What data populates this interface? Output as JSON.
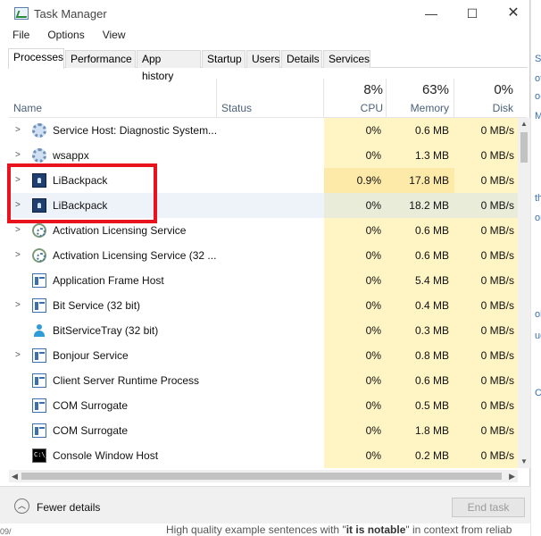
{
  "window": {
    "title": "Task Manager",
    "min": "—",
    "max": "☐",
    "close": "✕"
  },
  "menu": [
    "File",
    "Options",
    "View"
  ],
  "tabs": [
    "Processes",
    "Performance",
    "App history",
    "Startup",
    "Users",
    "Details",
    "Services"
  ],
  "header": {
    "name": "Name",
    "status": "Status",
    "cpu_pct": "8%",
    "cpu": "CPU",
    "mem_pct": "63%",
    "mem": "Memory",
    "disk_pct": "0%",
    "disk": "Disk"
  },
  "rows": [
    {
      "name": "Service Host: Diagnostic System...",
      "cpu": "0%",
      "mem": "0.6 MB",
      "disk": "0 MB/s",
      "icon": "gear-icon",
      "expand": true
    },
    {
      "name": "wsappx",
      "cpu": "0%",
      "mem": "1.3 MB",
      "disk": "0 MB/s",
      "icon": "gear-icon",
      "expand": true
    },
    {
      "name": "LiBackpack",
      "cpu": "0.9%",
      "mem": "17.8 MB",
      "disk": "0 MB/s",
      "icon": "lock-app-icon",
      "expand": true
    },
    {
      "name": "LiBackpack",
      "cpu": "0%",
      "mem": "18.2 MB",
      "disk": "0 MB/s",
      "icon": "lock-app-icon",
      "expand": true
    },
    {
      "name": "Activation Licensing Service",
      "cpu": "0%",
      "mem": "0.6 MB",
      "disk": "0 MB/s",
      "icon": "license-icon",
      "expand": true
    },
    {
      "name": "Activation Licensing Service (32 ...",
      "cpu": "0%",
      "mem": "0.6 MB",
      "disk": "0 MB/s",
      "icon": "license-icon",
      "expand": true
    },
    {
      "name": "Application Frame Host",
      "cpu": "0%",
      "mem": "5.4 MB",
      "disk": "0 MB/s",
      "icon": "window-icon",
      "expand": false
    },
    {
      "name": "Bit Service (32 bit)",
      "cpu": "0%",
      "mem": "0.4 MB",
      "disk": "0 MB/s",
      "icon": "window-icon",
      "expand": true
    },
    {
      "name": "BitServiceTray (32 bit)",
      "cpu": "0%",
      "mem": "0.3 MB",
      "disk": "0 MB/s",
      "icon": "user-icon",
      "expand": false
    },
    {
      "name": "Bonjour Service",
      "cpu": "0%",
      "mem": "0.8 MB",
      "disk": "0 MB/s",
      "icon": "window-icon",
      "expand": true
    },
    {
      "name": "Client Server Runtime Process",
      "cpu": "0%",
      "mem": "0.6 MB",
      "disk": "0 MB/s",
      "icon": "window-icon",
      "expand": false
    },
    {
      "name": "COM Surrogate",
      "cpu": "0%",
      "mem": "0.5 MB",
      "disk": "0 MB/s",
      "icon": "window-icon",
      "expand": false
    },
    {
      "name": "COM Surrogate",
      "cpu": "0%",
      "mem": "1.8 MB",
      "disk": "0 MB/s",
      "icon": "window-icon",
      "expand": false
    },
    {
      "name": "Console Window Host",
      "cpu": "0%",
      "mem": "0.2 MB",
      "disk": "0 MB/s",
      "icon": "console-icon",
      "expand": false
    }
  ],
  "footer": {
    "fewer_details": "Fewer details",
    "end_task": "End task"
  },
  "background": {
    "bottom_text_prefix": "High quality example sentences with \"",
    "bottom_text_bold": "it is notable",
    "bottom_text_suffix": "\" in context from reliab"
  }
}
